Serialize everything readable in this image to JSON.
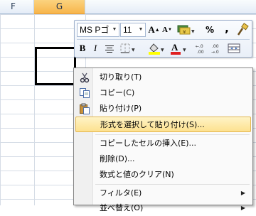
{
  "sheet": {
    "columns": [
      {
        "label": "F",
        "selected": false
      },
      {
        "label": "G",
        "selected": true
      }
    ]
  },
  "mini_toolbar": {
    "font_name": "MS Pゴ",
    "font_size": "11",
    "percent_symbol": "%",
    "comma_symbol": ",",
    "bold": "B",
    "italic": "I",
    "font_color_letter": "A",
    "grow_font": "A",
    "shrink_font": "A",
    "font_color_hex": "#e02020",
    "highlight_color_hex": "#ffff00"
  },
  "context_menu": {
    "items": [
      {
        "label": "切り取り(T)",
        "icon": "scissors-icon"
      },
      {
        "label": "コピー(C)",
        "icon": "copy-icon"
      },
      {
        "label": "貼り付け(P)",
        "icon": "paste-icon"
      },
      {
        "label": "形式を選択して貼り付け(S)...",
        "icon": "",
        "highlighted": true
      },
      {
        "label": "コピーしたセルの挿入(E)...",
        "icon": ""
      },
      {
        "label": "削除(D)...",
        "icon": ""
      },
      {
        "label": "数式と値のクリア(N)",
        "icon": ""
      },
      {
        "label": "フィルタ(E)",
        "icon": "",
        "submenu": true
      },
      {
        "label": "並べ替え(O)",
        "icon": "",
        "submenu": true
      }
    ],
    "highlight_color": "#fde18f"
  }
}
